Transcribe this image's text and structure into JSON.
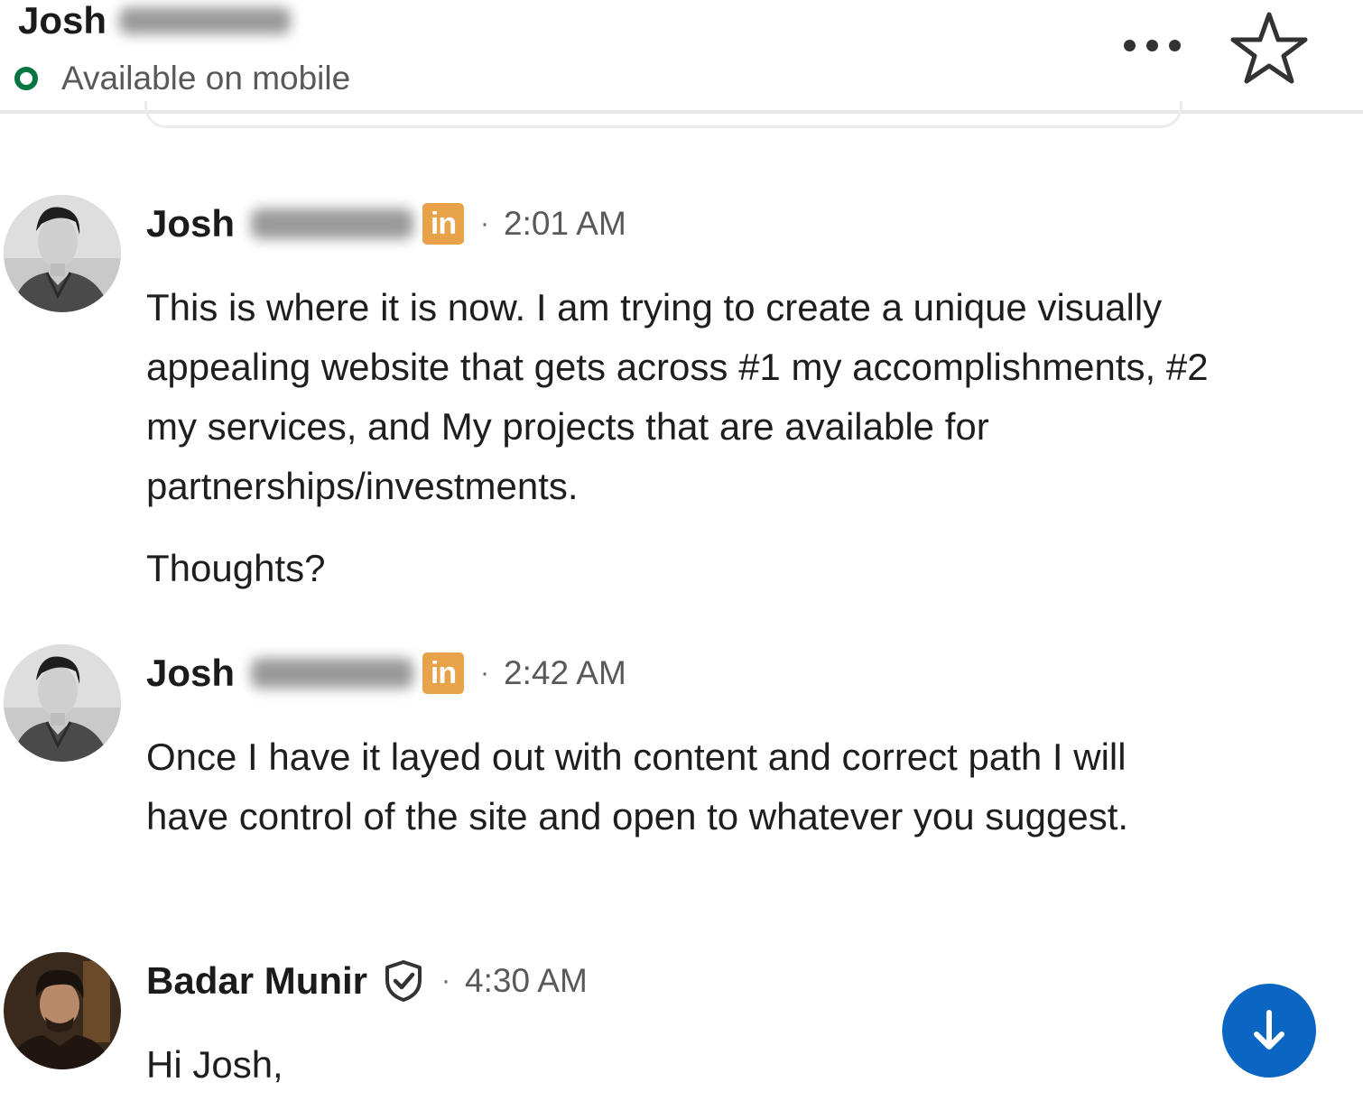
{
  "header": {
    "contact_name": "Josh",
    "presence_status": "Available on mobile",
    "more_icon": "ellipsis-icon",
    "star_icon": "star-icon",
    "status_color": "#057642"
  },
  "messages": [
    {
      "sender": "Josh",
      "badge": "in",
      "separator": "·",
      "time": "2:01 AM",
      "paragraphs": [
        "This is where it is now. I am trying to create a unique visually appealing website that gets across #1 my accomplishments, #2 my services, and My projects that are available for partnerships/investments.",
        "Thoughts?"
      ]
    },
    {
      "sender": "Josh",
      "badge": "in",
      "separator": "·",
      "time": "2:42 AM",
      "paragraphs": [
        "Once I have it layed out with content and correct path I will have control of the site and open to whatever you suggest."
      ]
    },
    {
      "sender": "Badar Munir",
      "verified_icon": "verified-shield-icon",
      "separator": "·",
      "time": "4:30 AM",
      "paragraphs": [
        "Hi Josh,"
      ]
    }
  ],
  "scroll_button": {
    "icon": "arrow-down-icon",
    "color": "#0a66c2"
  },
  "colors": {
    "linkedin_badge": "#e8a34a",
    "accent": "#0a66c2"
  }
}
